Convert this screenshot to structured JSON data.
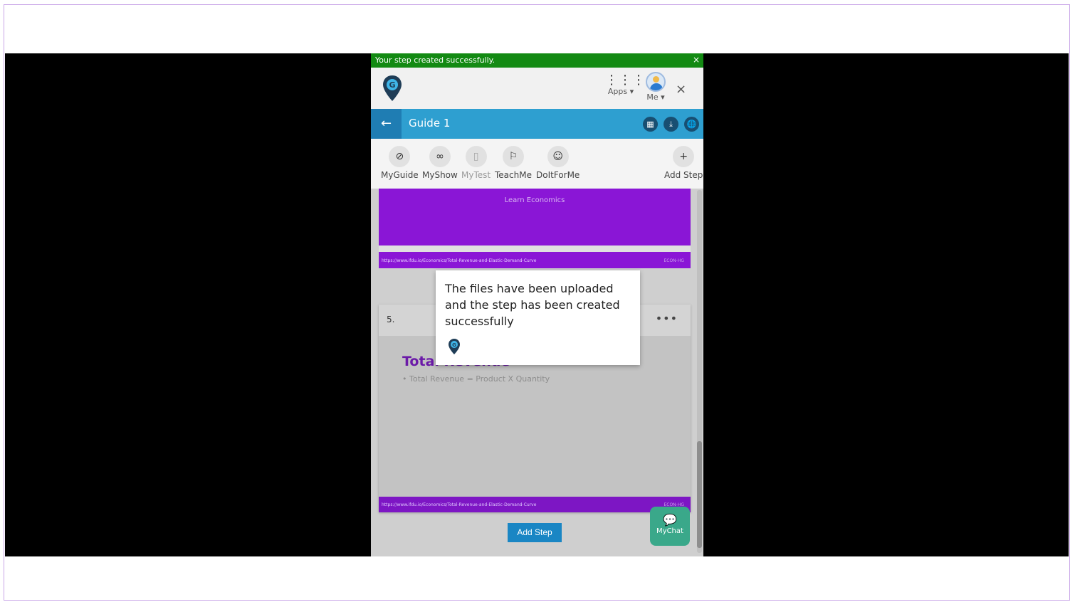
{
  "toast": {
    "message": "Your step created successfully.",
    "close": "×"
  },
  "header": {
    "apps_label": "Apps ▾",
    "apps_icon": "⋮⋮⋮",
    "me_label": "Me ▾",
    "close": "×"
  },
  "titlebar": {
    "back": "←",
    "title": "Guide 1",
    "icons": [
      "▦",
      "⤓",
      "🌐"
    ]
  },
  "modes": [
    {
      "label": "MyGuide",
      "icon": "⊘"
    },
    {
      "label": "MyShow",
      "icon": "∞"
    },
    {
      "label": "MyTest",
      "icon": "▯"
    },
    {
      "label": "TeachMe",
      "icon": "⚐"
    },
    {
      "label": "DoItForMe",
      "icon": "☺"
    },
    {
      "label": "Add Step",
      "icon": "+"
    }
  ],
  "card1": {
    "label": "Learn Economics",
    "url": "https://www.ifdu.io/Economics/Total-Revenue-and-Elastic-Demand-Curve",
    "code": "ECON-HG"
  },
  "card2": {
    "number": "5.",
    "more": "•••",
    "slide_title": "Total Revenue",
    "bullet": "• Total Revenue = Product X Quantity",
    "url": "https://www.ifdu.io/Economics/Total-Revenue-and-Elastic-Demand-Curve",
    "code": "ECON-HG"
  },
  "add_step_button": "Add Step",
  "mychat": {
    "label": "MyChat",
    "icon": "💬"
  },
  "tooltip": {
    "message": "The files have been uploaded and the step has been created successfully"
  },
  "colors": {
    "toast": "#138a13",
    "titlebar": "#2e9fd0",
    "slide_purple": "#8a16d6",
    "mychat": "#3aa88a",
    "accent_blue": "#1a86c4"
  }
}
